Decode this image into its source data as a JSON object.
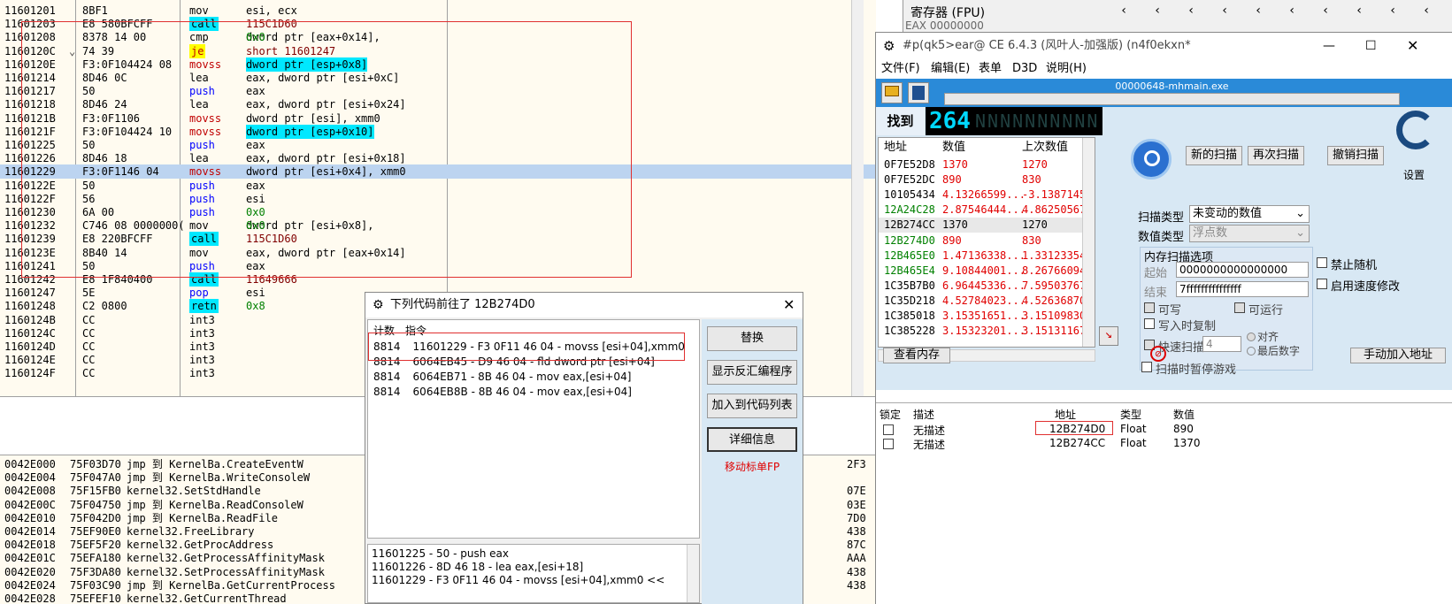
{
  "disasm": {
    "rows": [
      {
        "addr": "11601201",
        "bytes": "8BF1",
        "mn": "mov",
        "mnClass": "",
        "op": "esi, ecx",
        "arrow": ""
      },
      {
        "addr": "11601203",
        "bytes": "E8 580BFCFF",
        "mn": "call",
        "mnClass": "mn-call",
        "op": "115C1D60",
        "opClass": "op-red",
        "arrow": ""
      },
      {
        "addr": "11601208",
        "bytes": "8378 14 00",
        "mn": "cmp",
        "mnClass": "",
        "op": "dword ptr [eax+0x14], ",
        "op2": "0x0",
        "op2Class": "op-green",
        "arrow": ""
      },
      {
        "addr": "1160120C",
        "bytes": "74 39",
        "mn": "je",
        "mnClass": "mn-jmp",
        "op": "short 11601247",
        "opClass": "op-red",
        "arrow": "⌄"
      },
      {
        "addr": "1160120E",
        "bytes": "F3:0F104424 08",
        "mn": "movss",
        "mnClass": "mn-movss",
        "op": "xmm0, ",
        "op2": "dword ptr [esp+0x8]",
        "op2Class": "op-hl",
        "arrow": ""
      },
      {
        "addr": "11601214",
        "bytes": "8D46 0C",
        "mn": "lea",
        "mnClass": "",
        "op": "eax, dword ptr [esi+0xC]",
        "arrow": ""
      },
      {
        "addr": "11601217",
        "bytes": "50",
        "mn": "push",
        "mnClass": "mn-push",
        "op": "eax",
        "arrow": ""
      },
      {
        "addr": "11601218",
        "bytes": "8D46 24",
        "mn": "lea",
        "mnClass": "",
        "op": "eax, dword ptr [esi+0x24]",
        "arrow": ""
      },
      {
        "addr": "1160121B",
        "bytes": "F3:0F1106",
        "mn": "movss",
        "mnClass": "mn-movss",
        "op": "dword ptr [esi], xmm0",
        "arrow": ""
      },
      {
        "addr": "1160121F",
        "bytes": "F3:0F104424 10",
        "mn": "movss",
        "mnClass": "mn-movss",
        "op": "xmm0, ",
        "op2": "dword ptr [esp+0x10]",
        "op2Class": "op-hl",
        "arrow": ""
      },
      {
        "addr": "11601225",
        "bytes": "50",
        "mn": "push",
        "mnClass": "mn-push",
        "op": "eax",
        "arrow": ""
      },
      {
        "addr": "11601226",
        "bytes": "8D46 18",
        "mn": "lea",
        "mnClass": "",
        "op": "eax, dword ptr [esi+0x18]",
        "arrow": ""
      },
      {
        "addr": "11601229",
        "bytes": "F3:0F1146 04",
        "mn": "movss",
        "mnClass": "mn-movss",
        "op": "dword ptr [esi+0x4], xmm0",
        "arrow": "",
        "sel": true
      },
      {
        "addr": "1160122E",
        "bytes": "50",
        "mn": "push",
        "mnClass": "mn-push",
        "op": "eax",
        "arrow": ""
      },
      {
        "addr": "1160122F",
        "bytes": "56",
        "mn": "push",
        "mnClass": "mn-push",
        "op": "esi",
        "arrow": ""
      },
      {
        "addr": "11601230",
        "bytes": "6A 00",
        "mn": "push",
        "mnClass": "mn-push",
        "op": "0x0",
        "opClass": "op-green",
        "arrow": ""
      },
      {
        "addr": "11601232",
        "bytes": "C746 08 0000000(",
        "mn": "mov",
        "mnClass": "",
        "op": "dword ptr [esi+0x8], ",
        "op2": "0x0",
        "op2Class": "op-green",
        "arrow": ""
      },
      {
        "addr": "11601239",
        "bytes": "E8 220BFCFF",
        "mn": "call",
        "mnClass": "mn-call",
        "op": "115C1D60",
        "opClass": "op-red",
        "arrow": ""
      },
      {
        "addr": "1160123E",
        "bytes": "8B40 14",
        "mn": "mov",
        "mnClass": "",
        "op": "eax, dword ptr [eax+0x14]",
        "arrow": ""
      },
      {
        "addr": "11601241",
        "bytes": "50",
        "mn": "push",
        "mnClass": "mn-push",
        "op": "eax",
        "arrow": ""
      },
      {
        "addr": "11601242",
        "bytes": "E8 1F840400",
        "mn": "call",
        "mnClass": "mn-call",
        "op": "11649666",
        "opClass": "op-red",
        "arrow": ""
      },
      {
        "addr": "11601247",
        "bytes": "5E",
        "mn": "pop",
        "mnClass": "mn-push",
        "op": "esi",
        "arrow": ""
      },
      {
        "addr": "11601248",
        "bytes": "C2 0800",
        "mn": "retn",
        "mnClass": "mn-retn",
        "op": "0x8",
        "opClass": "op-green",
        "arrow": ""
      },
      {
        "addr": "1160124B",
        "bytes": "CC",
        "mn": "int3",
        "mnClass": "",
        "op": "",
        "arrow": ""
      },
      {
        "addr": "1160124C",
        "bytes": "CC",
        "mn": "int3",
        "mnClass": "",
        "op": "",
        "arrow": ""
      },
      {
        "addr": "1160124D",
        "bytes": "CC",
        "mn": "int3",
        "mnClass": "",
        "op": "",
        "arrow": ""
      },
      {
        "addr": "1160124E",
        "bytes": "CC",
        "mn": "int3",
        "mnClass": "",
        "op": "",
        "arrow": ""
      },
      {
        "addr": "1160124F",
        "bytes": "CC",
        "mn": "int3",
        "mnClass": "",
        "op": "",
        "arrow": ""
      }
    ]
  },
  "dump": {
    "rows": [
      {
        "addr": "0042E000",
        "val": "75F03D70",
        "txt": "jmp 到 KernelBa.CreateEventW",
        "right": "2F3"
      },
      {
        "addr": "0042E004",
        "val": "75F047A0",
        "txt": "jmp 到 KernelBa.WriteConsoleW",
        "right": ""
      },
      {
        "addr": "0042E008",
        "val": "75F15FB0",
        "txt": "kernel32.SetStdHandle",
        "right": "07E"
      },
      {
        "addr": "0042E00C",
        "val": "75F04750",
        "txt": "jmp 到 KernelBa.ReadConsoleW",
        "right": "03E"
      },
      {
        "addr": "0042E010",
        "val": "75F042D0",
        "txt": "jmp 到 KernelBa.ReadFile",
        "right": "7D0"
      },
      {
        "addr": "0042E014",
        "val": "75EF90E0",
        "txt": "kernel32.FreeLibrary",
        "right": "438"
      },
      {
        "addr": "0042E018",
        "val": "75EF5F20",
        "txt": "kernel32.GetProcAddress",
        "right": "87C"
      },
      {
        "addr": "0042E01C",
        "val": "75EFA180",
        "txt": "kernel32.GetProcessAffinityMask",
        "right": "AAA"
      },
      {
        "addr": "0042E020",
        "val": "75F3DA80",
        "txt": "kernel32.SetProcessAffinityMask",
        "right": "438"
      },
      {
        "addr": "0042E024",
        "val": "75F03C90",
        "txt": "jmp 到 KernelBa.GetCurrentProcess",
        "right": "438"
      },
      {
        "addr": "0042E028",
        "val": "75EFEF10",
        "txt": "kernel32.GetCurrentThread",
        "right": ""
      }
    ]
  },
  "regs": {
    "title": "寄存器 (FPU)",
    "eax": "EAX 00000000"
  },
  "ce": {
    "title": "#p(qk5>ear@  CE 6.4.3 (风叶人-加强版)  (n4f0ekxn*",
    "menu": [
      "文件(F)",
      "编辑(E)",
      "表单",
      "D3D",
      "说明(H)"
    ],
    "process": "00000648-mhmain.exe",
    "found": "找到",
    "count": "264",
    "resultHeaders": [
      "地址",
      "数值",
      "上次数值"
    ],
    "results": [
      {
        "addr": "0F7E52D8",
        "val": "1370",
        "prev": "1270",
        "color": "black",
        "valColor": "red"
      },
      {
        "addr": "0F7E52DC",
        "val": "890",
        "prev": "830",
        "color": "black",
        "valColor": "red"
      },
      {
        "addr": "10105434",
        "val": "4.13266599...",
        "prev": "-3.1387145...",
        "color": "black",
        "valColor": "red"
      },
      {
        "addr": "12A24C28",
        "val": "2.87546444...",
        "prev": "4.86250567...",
        "color": "green",
        "valColor": "red"
      },
      {
        "addr": "12B274CC",
        "val": "1370",
        "prev": "1270",
        "color": "black",
        "valColor": "black",
        "hl": true
      },
      {
        "addr": "12B274D0",
        "val": "890",
        "prev": "830",
        "color": "green",
        "valColor": "red"
      },
      {
        "addr": "12B465E0",
        "val": "1.47136338...",
        "prev": "1.33123354...",
        "color": "green",
        "valColor": "red"
      },
      {
        "addr": "12B465E4",
        "val": "9.10844001...",
        "prev": "8.26766094...",
        "color": "green",
        "valColor": "red"
      },
      {
        "addr": "1C35B7B0",
        "val": "6.96445336...",
        "prev": "7.59503767...",
        "color": "black",
        "valColor": "red"
      },
      {
        "addr": "1C35D218",
        "val": "4.52784023...",
        "prev": "4.52636870...",
        "color": "black",
        "valColor": "red"
      },
      {
        "addr": "1C385018",
        "val": "3.15351651...",
        "prev": "3.15109830...",
        "color": "black",
        "valColor": "red"
      },
      {
        "addr": "1C385228",
        "val": "3.15323201...",
        "prev": "3.15131167...",
        "color": "black",
        "valColor": "red"
      }
    ],
    "btnNewScan": "新的扫描",
    "btnNextScan": "再次扫描",
    "btnUndo": "撤销扫描",
    "settings": "设置",
    "scanTypeLabel": "扫描类型",
    "scanType": "未变动的数值",
    "valueTypeLabel": "数值类型",
    "valueType": "浮点数",
    "memOptions": "内存扫描选项",
    "startLabel": "起始",
    "start": "0000000000000000",
    "endLabel": "结束",
    "end": "7fffffffffffffff",
    "writable": "可写",
    "executable": "可运行",
    "copyOnWrite": "写入时复制",
    "fastScan": "快速扫描",
    "fastScanVal": "4",
    "align": "对齐",
    "lastDigits": "最后数字",
    "pauseGame": "扫描时暂停游戏",
    "noRandom": "禁止随机",
    "speedhack": "启用速度修改",
    "viewMemory": "查看内存",
    "addManual": "手动加入地址",
    "tableHeaders": [
      "锁定",
      "描述",
      "地址",
      "类型",
      "数值"
    ],
    "table": [
      {
        "desc": "无描述",
        "addr": "12B274D0",
        "type": "Float",
        "val": "890"
      },
      {
        "desc": "无描述",
        "addr": "12B274CC",
        "type": "Float",
        "val": "1370"
      }
    ]
  },
  "dialog": {
    "title": "下列代码前往了 12B274D0",
    "headers": [
      "计数",
      "指令"
    ],
    "rows": [
      {
        "count": "8814",
        "text": "11601229 - F3 0F11 46 04  - movss [esi+04],xmm0"
      },
      {
        "count": "8814",
        "text": "6064EB45 - D9 46 04  - fld dword ptr [esi+04]"
      },
      {
        "count": "8814",
        "text": "6064EB71 - 8B 46 04  - mov eax,[esi+04]"
      },
      {
        "count": "8814",
        "text": "6064EB8B - 8B 46 04  - mov eax,[esi+04]"
      }
    ],
    "btnReplace": "替换",
    "btnDisasm": "显示反汇编程序",
    "btnAddCode": "加入到代码列表",
    "btnDetails": "详细信息",
    "fpLabel": "移动标单FP",
    "bottom": [
      "11601225 - 50 - push eax",
      "11601226 - 8D 46 18  - lea eax,[esi+18]",
      "11601229 - F3 0F11 46 04  - movss [esi+04],xmm0 <<"
    ]
  }
}
